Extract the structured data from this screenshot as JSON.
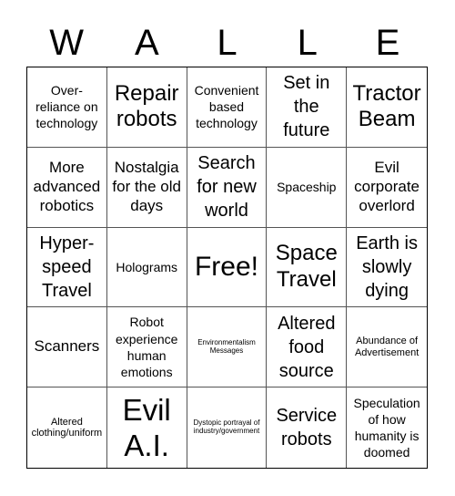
{
  "header": {
    "letters": [
      "W",
      "A",
      "L",
      "L",
      "E"
    ]
  },
  "cells": [
    {
      "text": "Over-reliance on technology",
      "size": "s-md"
    },
    {
      "text": "Repair robots",
      "size": "s-xxl"
    },
    {
      "text": "Convenient based technology",
      "size": "s-md"
    },
    {
      "text": "Set in the future",
      "size": "s-xl"
    },
    {
      "text": "Tractor Beam",
      "size": "s-xxl"
    },
    {
      "text": "More advanced robotics",
      "size": "s-lg"
    },
    {
      "text": "Nostalgia for the old days",
      "size": "s-lg"
    },
    {
      "text": "Search for new world",
      "size": "s-xl"
    },
    {
      "text": "Spaceship",
      "size": "s-md"
    },
    {
      "text": "Evil corporate overlord",
      "size": "s-lg"
    },
    {
      "text": "Hyper-speed Travel",
      "size": "s-xl"
    },
    {
      "text": "Holograms",
      "size": "s-md"
    },
    {
      "text": "Free!",
      "size": "s-huge"
    },
    {
      "text": "Space Travel",
      "size": "s-xxl"
    },
    {
      "text": "Earth is slowly dying",
      "size": "s-xl"
    },
    {
      "text": "Scanners",
      "size": "s-lg"
    },
    {
      "text": "Robot experience human emotions",
      "size": "s-md"
    },
    {
      "text": "Environmentalism Messages",
      "size": "s-xs"
    },
    {
      "text": "Altered food source",
      "size": "s-xl"
    },
    {
      "text": "Abundance of Advertisement",
      "size": "s-sm"
    },
    {
      "text": "Altered clothing/uniform",
      "size": "s-sm"
    },
    {
      "text": "Evil A.I.",
      "size": "s-giant"
    },
    {
      "text": "Dystopic portrayal of industry/government",
      "size": "s-xs"
    },
    {
      "text": "Service robots",
      "size": "s-xl"
    },
    {
      "text": "Speculation of how humanity is doomed",
      "size": "s-md"
    }
  ]
}
